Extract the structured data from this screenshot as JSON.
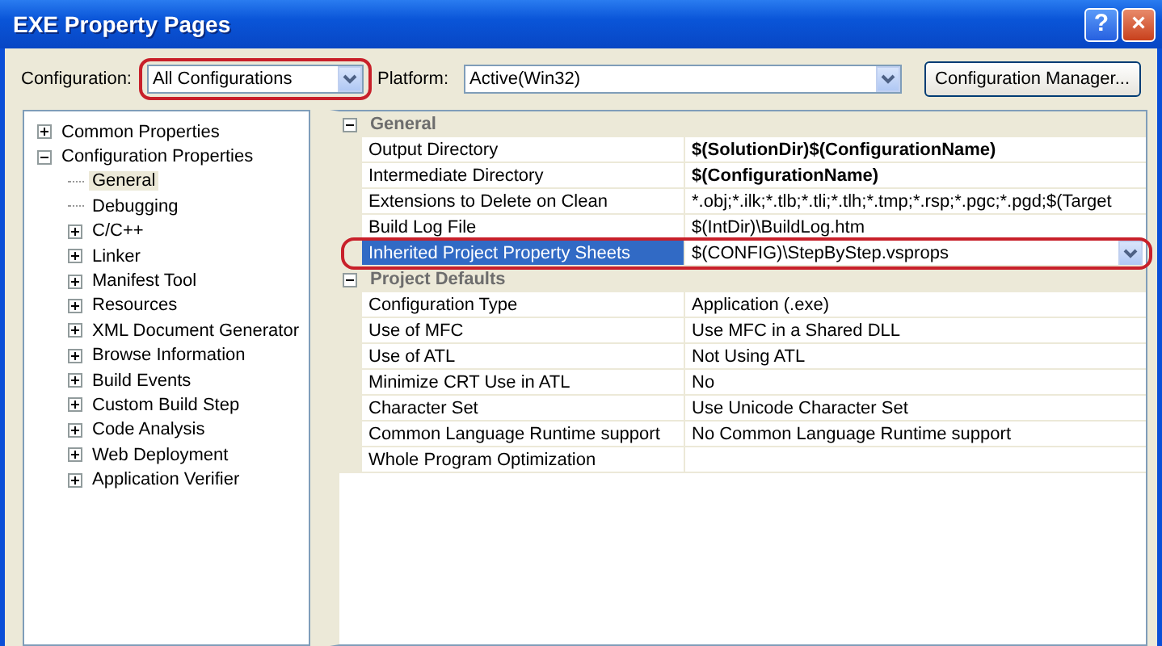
{
  "window": {
    "title": "EXE Property Pages",
    "help_button": "?",
    "close_button": "×"
  },
  "configuration": {
    "label": "Configuration:",
    "value": "All Configurations",
    "annotated": true
  },
  "platform": {
    "label": "Platform:",
    "value": "Active(Win32)",
    "annotated": false
  },
  "manager_button": "Configuration Manager...",
  "tree": [
    {
      "label": "Common Properties",
      "kind": "folder",
      "expanded": false,
      "selected": false
    },
    {
      "label": "Configuration Properties",
      "kind": "folder",
      "expanded": true,
      "selected": false,
      "children": [
        {
          "label": "General",
          "kind": "leaf",
          "selected": true
        },
        {
          "label": "Debugging",
          "kind": "leaf",
          "selected": false
        },
        {
          "label": "C/C++",
          "kind": "folder",
          "expanded": false,
          "selected": false
        },
        {
          "label": "Linker",
          "kind": "folder",
          "expanded": false,
          "selected": false
        },
        {
          "label": "Manifest Tool",
          "kind": "folder",
          "expanded": false,
          "selected": false
        },
        {
          "label": "Resources",
          "kind": "folder",
          "expanded": false,
          "selected": false
        },
        {
          "label": "XML Document Generator",
          "kind": "folder",
          "expanded": false,
          "selected": false
        },
        {
          "label": "Browse Information",
          "kind": "folder",
          "expanded": false,
          "selected": false
        },
        {
          "label": "Build Events",
          "kind": "folder",
          "expanded": false,
          "selected": false
        },
        {
          "label": "Custom Build Step",
          "kind": "folder",
          "expanded": false,
          "selected": false
        },
        {
          "label": "Code Analysis",
          "kind": "folder",
          "expanded": false,
          "selected": false
        },
        {
          "label": "Web Deployment",
          "kind": "folder",
          "expanded": false,
          "selected": false
        },
        {
          "label": "Application Verifier",
          "kind": "folder",
          "expanded": false,
          "selected": false
        }
      ]
    }
  ],
  "grid": [
    {
      "category": "General",
      "expanded": true,
      "properties": [
        {
          "name": "Output Directory",
          "value": "$(SolutionDir)$(ConfigurationName)",
          "bold": true,
          "selected": false,
          "annotated": false
        },
        {
          "name": "Intermediate Directory",
          "value": "$(ConfigurationName)",
          "bold": true,
          "selected": false,
          "annotated": false
        },
        {
          "name": "Extensions to Delete on Clean",
          "value": "*.obj;*.ilk;*.tlb;*.tli;*.tlh;*.tmp;*.rsp;*.pgc;*.pgd;$(Target",
          "bold": false,
          "selected": false,
          "annotated": false
        },
        {
          "name": "Build Log File",
          "value": "$(IntDir)\\BuildLog.htm",
          "bold": false,
          "selected": false,
          "annotated": false
        },
        {
          "name": "Inherited Project Property Sheets",
          "value": "$(CONFIG)\\StepByStep.vsprops",
          "bold": false,
          "selected": true,
          "annotated": true
        }
      ]
    },
    {
      "category": "Project Defaults",
      "expanded": true,
      "properties": [
        {
          "name": "Configuration Type",
          "value": "Application (.exe)",
          "bold": false,
          "selected": false,
          "annotated": false
        },
        {
          "name": "Use of MFC",
          "value": "Use MFC in a Shared DLL",
          "bold": false,
          "selected": false,
          "annotated": false
        },
        {
          "name": "Use of ATL",
          "value": "Not Using ATL",
          "bold": false,
          "selected": false,
          "annotated": false
        },
        {
          "name": "Minimize CRT Use in ATL",
          "value": "No",
          "bold": false,
          "selected": false,
          "annotated": false
        },
        {
          "name": "Character Set",
          "value": "Use Unicode Character Set",
          "bold": false,
          "selected": false,
          "annotated": false
        },
        {
          "name": "Common Language Runtime support",
          "value": "No Common Language Runtime support",
          "bold": false,
          "selected": false,
          "annotated": false
        },
        {
          "name": "Whole Program Optimization",
          "bold": false,
          "selected": false,
          "annotated": false
        }
      ]
    }
  ]
}
